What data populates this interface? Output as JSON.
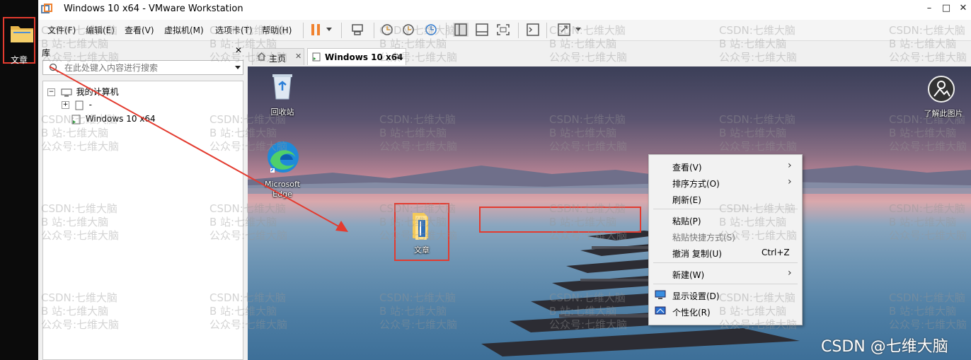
{
  "host": {
    "folder_label": "文章"
  },
  "window": {
    "title": "Windows 10 x64 - VMware Workstation",
    "controls": {
      "minimize": "–",
      "maximize": "□",
      "close": "✕"
    }
  },
  "menu": [
    "文件(F)",
    "编辑(E)",
    "查看(V)",
    "虚拟机(M)",
    "选项卡(T)",
    "帮助(H)"
  ],
  "library": {
    "title": "库",
    "close": "✕",
    "search_placeholder": "在此处键入内容进行搜索",
    "tree": {
      "root": "我的计算机",
      "items": [
        "-",
        "Windows 10 x64"
      ]
    }
  },
  "tabs": [
    {
      "label": "主页",
      "close": "✕"
    },
    {
      "label": "Windows 10 x64",
      "close": "✕"
    }
  ],
  "guest": {
    "recycle_bin": "回收站",
    "edge": "Microsoft Edge",
    "folder": "文章",
    "learn_picture": "了解此图片"
  },
  "context_menu": [
    {
      "label": "查看(V)",
      "submenu": true
    },
    {
      "label": "排序方式(O)",
      "submenu": true
    },
    {
      "label": "刷新(E)"
    },
    {
      "label": "粘贴(P)"
    },
    {
      "label": "粘贴快捷方式(S)"
    },
    {
      "label": "撤消 复制(U)",
      "shortcut": "Ctrl+Z"
    },
    {
      "label": "新建(W)",
      "submenu": true
    },
    {
      "label": "显示设置(D)"
    },
    {
      "label": "个性化(R)"
    }
  ],
  "watermark": {
    "line1": "CSDN:七维大脑",
    "line2": "B 站:七维大脑",
    "line3": "公众号:七维大脑",
    "signature": "CSDN @七维大脑"
  },
  "colors": {
    "highlight": "#e33b2f",
    "pause": "#f0822f"
  }
}
